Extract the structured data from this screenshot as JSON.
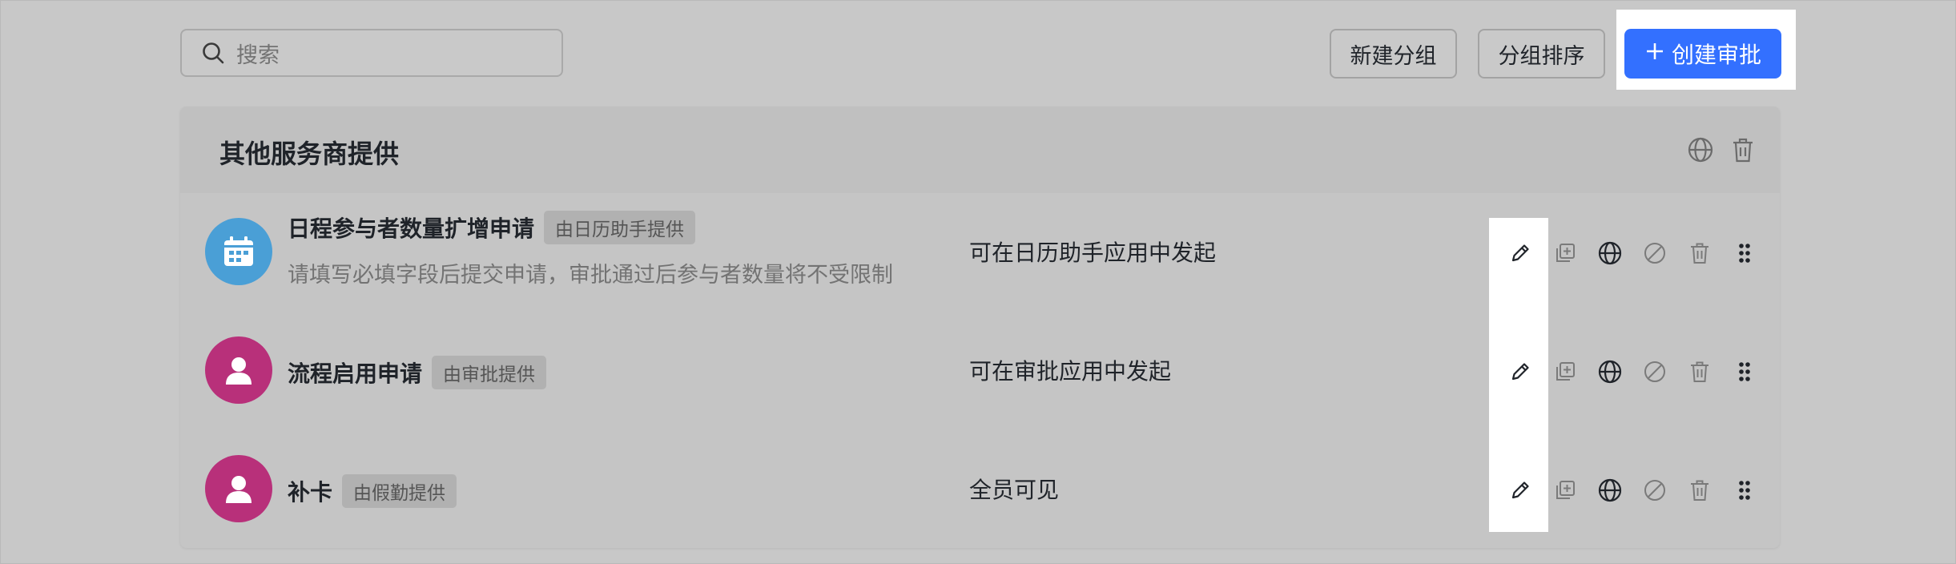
{
  "search": {
    "placeholder": "搜索"
  },
  "toolbar": {
    "new_group_label": "新建分组",
    "sort_group_label": "分组排序",
    "create_label": "创建审批",
    "create_icon": "plus-icon"
  },
  "colors": {
    "accent": "#3370ff",
    "calendar_avatar": "#4a9fd6",
    "person_avatar": "#b8307a"
  },
  "group": {
    "title": "其他服务商提供",
    "header_actions": [
      "globe-icon",
      "trash-icon"
    ],
    "row_actions": [
      "edit-icon",
      "copy-icon",
      "globe-icon",
      "disable-icon",
      "trash-icon",
      "drag-handle-icon"
    ],
    "rows": [
      {
        "name": "日程参与者数量扩增申请",
        "provider": "由日历助手提供",
        "description": "请填写必填字段后提交申请，审批通过后参与者数量将不受限制",
        "scope": "可在日历助手应用中发起",
        "avatar": "calendar-icon"
      },
      {
        "name": "流程启用申请",
        "provider": "由审批提供",
        "description": "",
        "scope": "可在审批应用中发起",
        "avatar": "person-icon"
      },
      {
        "name": "补卡",
        "provider": "由假勤提供",
        "description": "",
        "scope": "全员可见",
        "avatar": "person-icon"
      }
    ]
  }
}
